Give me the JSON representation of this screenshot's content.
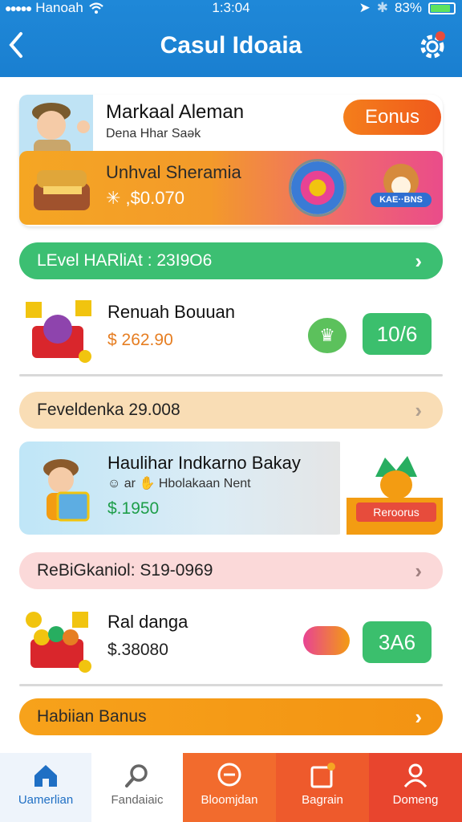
{
  "status": {
    "carrier": "Hanoah",
    "time": "1:3:04",
    "battery": "83%"
  },
  "header": {
    "title": "Casul Idoaia"
  },
  "hero": {
    "name": "Markaal Aleman",
    "subtitle": "Dena Hhar Saək",
    "bonus_label": "Eonus",
    "banner_title": "Unhval Sheramia",
    "banner_amount": "✳ ,$0.070",
    "badge": "KAE··BNS"
  },
  "level_bar": {
    "label": "LEvel HARliAt : 23I9O6"
  },
  "reward1": {
    "title": "Renuah Bouuan",
    "amount": "$ 262.90",
    "tag": "10/6"
  },
  "bar2": {
    "label": "Feveldenka 29.008"
  },
  "promo": {
    "title": "Haulihar Indkarno Bakay",
    "subtitle": "☺ ar ✋ Hbolakaan Nent",
    "amount": "$.1950",
    "ribbon": "Reroorus"
  },
  "bar3": {
    "label": "ReBiGkaniol: S19-0969"
  },
  "reward2": {
    "title": "Ral danga",
    "amount": "$.38080",
    "tag": "3A6"
  },
  "bonus_bar": {
    "label": "Habiian Banus"
  },
  "nav": {
    "items": [
      "Uamerlian",
      "Fandaiaic",
      "Bloomjdan",
      "Bagrain",
      "Domeng"
    ]
  },
  "colors": {
    "primary": "#1a7fd0",
    "accent_orange": "#f39c12",
    "green": "#3bbf6d",
    "nav_red": "#e8452e"
  }
}
